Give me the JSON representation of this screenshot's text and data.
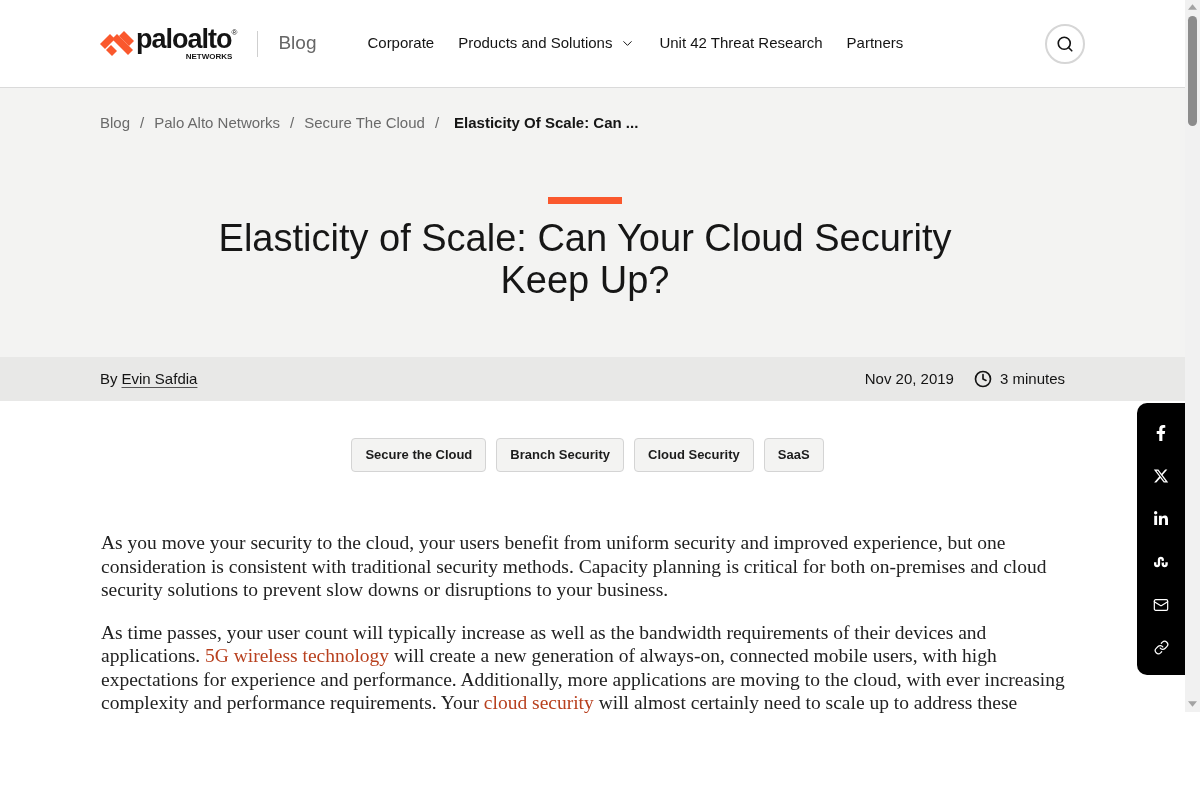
{
  "header": {
    "logo": {
      "wordmark": "paloalto",
      "registered": "®",
      "subtitle": "NETWORKS"
    },
    "section": "Blog",
    "nav": [
      {
        "label": "Corporate",
        "has_menu": false
      },
      {
        "label": "Products and Solutions",
        "has_menu": true
      },
      {
        "label": "Unit 42 Threat Research",
        "has_menu": false
      },
      {
        "label": "Partners",
        "has_menu": false
      }
    ]
  },
  "breadcrumbs": {
    "items": [
      {
        "label": "Blog",
        "current": false
      },
      {
        "label": "Palo Alto Networks",
        "current": false
      },
      {
        "label": "Secure The Cloud",
        "current": false
      },
      {
        "label": "Elasticity Of Scale: Can ...",
        "current": true
      }
    ],
    "separators": [
      "/",
      "/",
      "/"
    ]
  },
  "article": {
    "title": "Elasticity of Scale: Can Your Cloud Security Keep Up?",
    "byline": {
      "prefix": "By",
      "author": "Evin Safdia"
    },
    "date": "Nov 20, 2019",
    "read_time": "3 minutes",
    "tags": [
      "Secure the Cloud",
      "Branch Security",
      "Cloud Security",
      "SaaS"
    ],
    "paragraphs": [
      [
        {
          "kind": "text",
          "text": "As you move your security to the cloud, your users benefit from uniform security and improved experience, but one consideration is consistent with traditional security methods. Capacity planning is critical for both on-premises and cloud security solutions to prevent slow downs or disruptions to your business."
        }
      ],
      [
        {
          "kind": "text",
          "text": "As time passes, your user count will typically increase as well as the bandwidth requirements of their devices and applications. "
        },
        {
          "kind": "link",
          "text": "5G wireless technology"
        },
        {
          "kind": "text",
          "text": " will create a new generation of always-on, connected mobile users, with high expectations for experience and performance. Additionally, more applications are moving to the cloud, with ever increasing complexity and performance requirements. Your "
        },
        {
          "kind": "link",
          "text": "cloud security"
        },
        {
          "kind": "text",
          "text": " will almost certainly need to scale up to address these"
        }
      ]
    ]
  }
}
